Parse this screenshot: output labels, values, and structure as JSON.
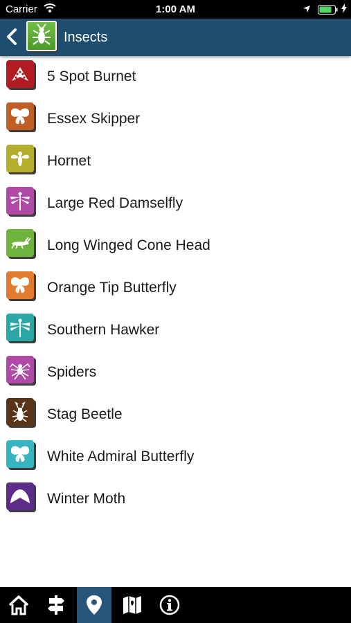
{
  "status": {
    "carrier": "Carrier",
    "time": "1:00 AM"
  },
  "header": {
    "title": "Insects",
    "logo_icon": "insect-logo-icon",
    "back_icon": "back-chevron-icon"
  },
  "items": [
    {
      "label": "5 Spot Burnet",
      "icon": "moth-icon",
      "color": "#b01c22"
    },
    {
      "label": "Essex Skipper",
      "icon": "butterfly-icon",
      "color": "#bf5f25"
    },
    {
      "label": "Hornet",
      "icon": "hornet-icon",
      "color": "#b5ad2c"
    },
    {
      "label": "Large Red Damselfly",
      "icon": "damselfly-icon",
      "color": "#b04aa7"
    },
    {
      "label": "Long Winged Cone Head",
      "icon": "grasshopper-icon",
      "color": "#6db33c"
    },
    {
      "label": "Orange Tip Butterfly",
      "icon": "butterfly-icon",
      "color": "#e27a30"
    },
    {
      "label": "Southern Hawker",
      "icon": "dragonfly-icon",
      "color": "#2ba7a8"
    },
    {
      "label": "Spiders",
      "icon": "spider-icon",
      "color": "#b04aa7"
    },
    {
      "label": "Stag Beetle",
      "icon": "beetle-icon",
      "color": "#5a3418"
    },
    {
      "label": "White Admiral Butterfly",
      "icon": "butterfly-icon",
      "color": "#36b4c0"
    },
    {
      "label": "Winter Moth",
      "icon": "moth-icon",
      "color": "#5b2d86"
    }
  ],
  "nav": [
    {
      "icon": "home-icon",
      "active": false
    },
    {
      "icon": "signpost-icon",
      "active": false
    },
    {
      "icon": "location-pin-icon",
      "active": true
    },
    {
      "icon": "map-icon",
      "active": false
    },
    {
      "icon": "info-icon",
      "active": false
    }
  ]
}
